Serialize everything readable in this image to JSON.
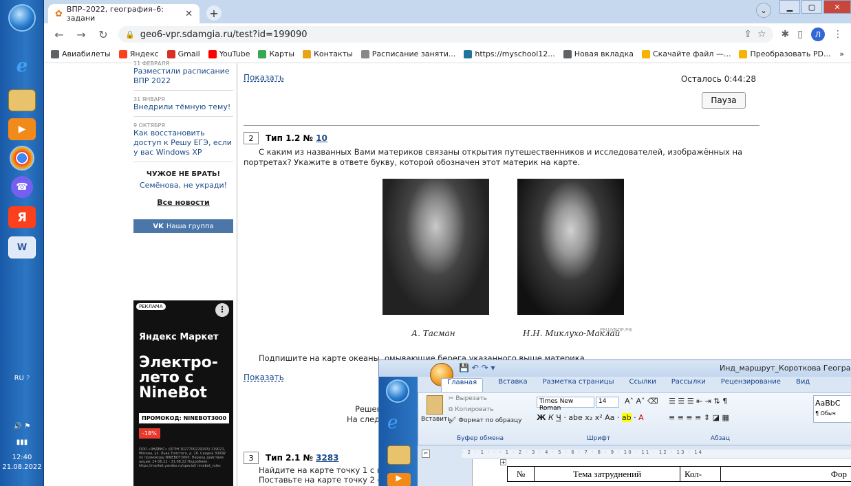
{
  "taskbar": {
    "lang": "RU",
    "time": "12:40",
    "date": "21.08.2022"
  },
  "browser": {
    "tab_title": "ВПР–2022, география–6: задани",
    "url": "geo6-vpr.sdamgia.ru/test?id=199090",
    "profile_initial": "Л",
    "bookmarks": [
      {
        "label": "Авиабилеты",
        "color": "#5f6368"
      },
      {
        "label": "Яндекс",
        "color": "#fc3f1d"
      },
      {
        "label": "Gmail",
        "color": "#d93025"
      },
      {
        "label": "YouTube",
        "color": "#ff0000"
      },
      {
        "label": "Карты",
        "color": "#34a853"
      },
      {
        "label": "Контакты",
        "color": "#e8a317"
      },
      {
        "label": "Расписание заняти...",
        "color": "#888888"
      },
      {
        "label": "https://myschool12...",
        "color": "#21759b"
      },
      {
        "label": "Новая вкладка",
        "color": "#5f6368"
      },
      {
        "label": "Скачайте файл —...",
        "color": "#f4b400"
      },
      {
        "label": "Преобразовать PD...",
        "color": "#f4b400"
      }
    ],
    "bookmarks_more": "»"
  },
  "sidebar": {
    "news": [
      {
        "date": "11 февраля",
        "text": "Разместили расписание ВПР 2022"
      },
      {
        "date": "31 января",
        "text": "Внедрили тёмную тему!"
      },
      {
        "date": "9 октября",
        "text": "Как восстановить доступ к Решу ЕГЭ, если у вас Windows XP"
      }
    ],
    "warning_title": "ЧУЖОЕ НЕ БРАТЬ!",
    "warning_text": "Семёнова, не укради!",
    "all_news": "Все новости",
    "vk_label": "Наша группа"
  },
  "ad": {
    "label": "РЕКЛАМА",
    "brand": "Яндекс Маркет",
    "headline": "Электро-лето с NineBot",
    "promo": "ПРОМОКОД: NINEBOT3000",
    "discount": "-18%",
    "fine_print": "ООО «ЯНДЕКС» (ОГРН 1027700229193) 119021, Москва, ул. Льва Толстого, д. 16. Скидка 3000₽ по промокоду NINEBOT3000. Период действия акции: 24.06.22 - 31.08.22 Подробнее: https://market.yandex.ru/special/ ninebot_rules"
  },
  "main": {
    "show_top": "Показать",
    "timer": "Осталось 0:44:28",
    "pause": "Пауза",
    "q2": {
      "num": "2",
      "type": "Тип 1.2 №",
      "id": "10",
      "text": "С каким из названных Вами материков связаны открытия путешественников и исследователей, изображённых на портретах? Укажите в ответе букву, которой обозначен этот материк на карте.",
      "caption1": "А. Тасман",
      "caption2": "Н.Н. Миклухо-Маклай",
      "watermark": "РЕШУВПР.РФ",
      "text2": "Подпишите на карте океаны, омывающие берега указанного выше материка.",
      "show": "Показать",
      "partial1": "Решен",
      "partial2": "На следу"
    },
    "q3": {
      "num": "3",
      "type": "Тип 2.1 №",
      "id": "3283",
      "line1": "Найдите на карте точку 1 с ко",
      "line2": "Поставьте на карте точку 2 с к"
    }
  },
  "word": {
    "title": "Инд_маршрут_Короткова География -",
    "tabs": [
      "Главная",
      "Вставка",
      "Разметка страницы",
      "Ссылки",
      "Рассылки",
      "Рецензирование",
      "Вид"
    ],
    "clipboard": {
      "paste": "Вставить",
      "cut": "Вырезать",
      "copy": "Копировать",
      "format": "Формат по образцу",
      "group": "Буфер обмена"
    },
    "font_name": "Times New Roman",
    "font_size": "14",
    "font_group": "Шрифт",
    "para_group": "Абзац",
    "style_preview": "AaBbC",
    "style_name": "¶ Обыч",
    "table": {
      "col1": "№",
      "col2": "Тема затруднений",
      "col3": "Кол-",
      "col4": "Фор"
    }
  }
}
